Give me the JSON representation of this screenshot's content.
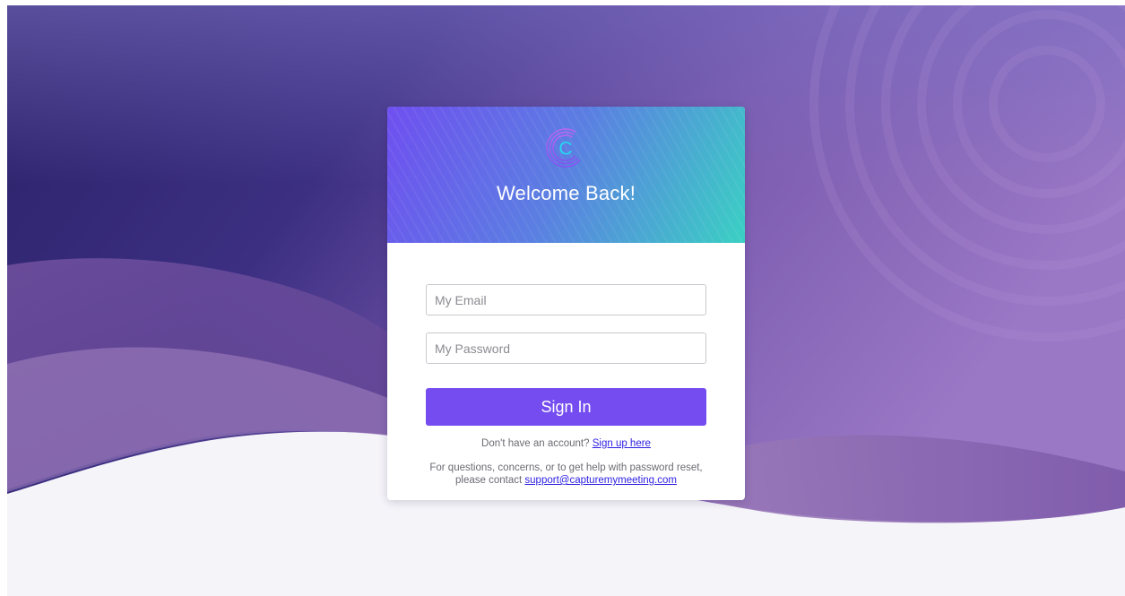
{
  "logo": {
    "icon": "capture-c-logo-icon",
    "letter": "C"
  },
  "header": {
    "title": "Welcome Back!"
  },
  "form": {
    "email_placeholder": "My Email",
    "password_placeholder": "My Password",
    "signin_label": "Sign In"
  },
  "signup": {
    "prompt": "Don't have an account?",
    "link_label": "Sign up here"
  },
  "help": {
    "line1": "For questions, concerns, or to get help with password reset,",
    "line2_prefix": "please contact",
    "email_link": "support@capturemymeeting.com"
  },
  "colors": {
    "primary": "#754cf0",
    "header_start": "#6f4ff0",
    "header_end": "#3ad0c3",
    "link": "#2c1ee0"
  }
}
